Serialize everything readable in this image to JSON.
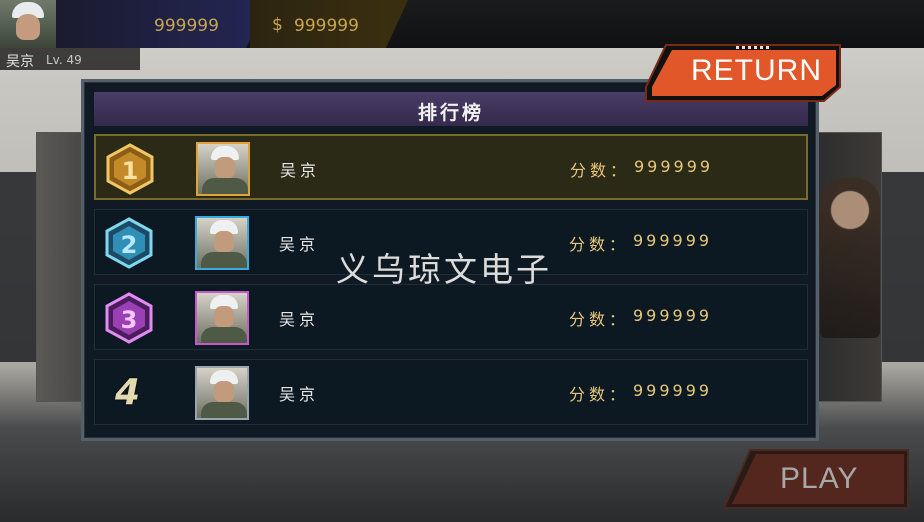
{
  "top_bar": {
    "gold_value": "999999",
    "cash_symbol": "$",
    "cash_value": "999999",
    "player_name": "吴京",
    "player_level": "Lv. 49"
  },
  "leaderboard": {
    "title": "排行榜",
    "score_label": "分数：",
    "rows": [
      {
        "rank": "1",
        "name": "吴京",
        "score": "999999",
        "badge_color": "#d9a441",
        "frame_color": "#e0a23a"
      },
      {
        "rank": "2",
        "name": "吴京",
        "score": "999999",
        "badge_color": "#47b8d6",
        "frame_color": "#3aa9e0"
      },
      {
        "rank": "3",
        "name": "吴京",
        "score": "999999",
        "badge_color": "#b457c9",
        "frame_color": "#c45ac8"
      },
      {
        "rank": "4",
        "name": "吴京",
        "score": "999999",
        "badge_color": "#e3d9b0",
        "frame_color": "#9aa4ad"
      }
    ]
  },
  "buttons": {
    "return_label": "RETURN",
    "play_label": "PLAY"
  },
  "colors": {
    "accent_orange": "#e2572a",
    "header_purple": "#3f3259",
    "score_gold": "#e6c77a"
  },
  "watermark": "义乌琼文电子"
}
